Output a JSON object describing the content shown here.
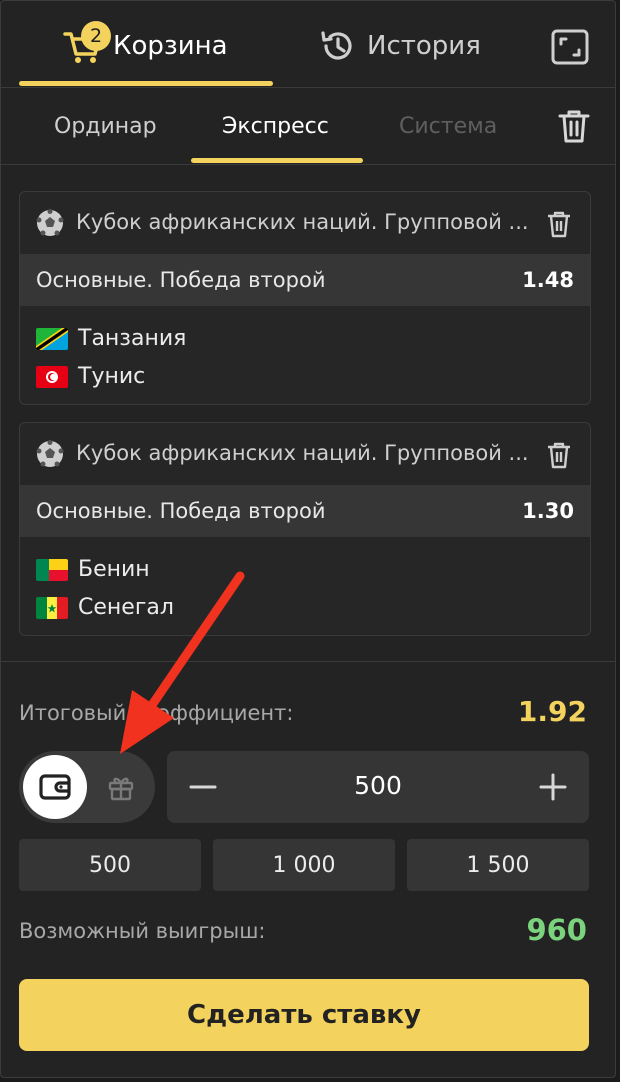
{
  "header": {
    "tabs": [
      {
        "label": "Корзина",
        "badge": "2",
        "icon": "cart-icon"
      },
      {
        "label": "История",
        "icon": "history-icon"
      }
    ],
    "extra_icon": "fullscreen-icon"
  },
  "bet_types": {
    "tabs": [
      "Ординар",
      "Экспресс",
      "Система"
    ],
    "active": "Экспресс",
    "trash_icon": "trash-icon"
  },
  "bets": [
    {
      "tournament": "Кубок африканских наций. Групповой ...",
      "market": "Основные. Победа второй",
      "odd": "1.48",
      "teams": [
        "Танзания",
        "Тунис"
      ]
    },
    {
      "tournament": "Кубок африканских наций. Групповой ...",
      "market": "Основные. Победа второй",
      "odd": "1.30",
      "teams": [
        "Бенин",
        "Сенегал"
      ]
    }
  ],
  "summary": {
    "total_label": "Итоговый коэффициент:",
    "total_value": "1.92",
    "stake": "500",
    "quick_amounts": [
      "500",
      "1 000",
      "1 500"
    ],
    "win_label": "Возможный выигрыш:",
    "win_value": "960",
    "bet_button": "Сделать ставку"
  },
  "colors": {
    "accent": "#f3d35d",
    "win": "#7bd37e",
    "annotation_arrow": "#f0321e"
  }
}
